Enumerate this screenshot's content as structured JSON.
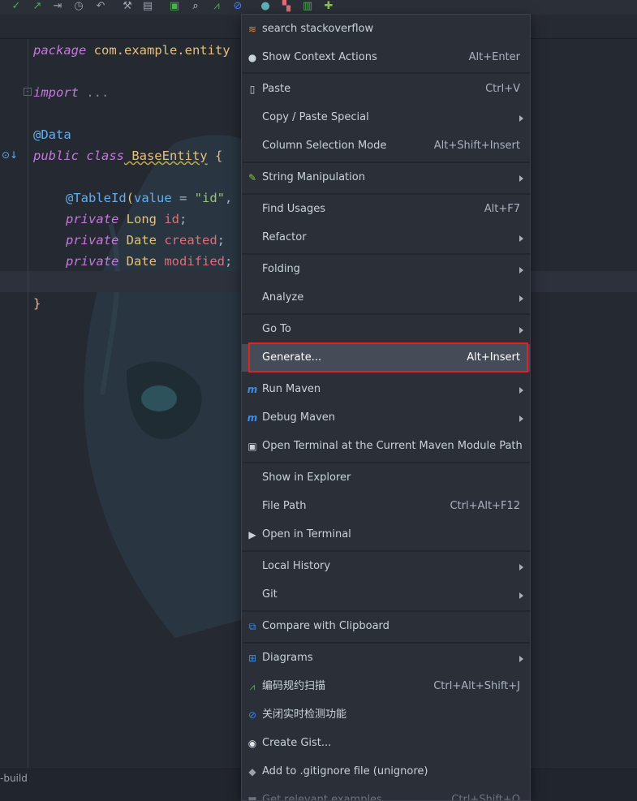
{
  "toolbar": {
    "icons": [
      "check-icon",
      "arrow-up-right-icon",
      "merge-icon",
      "history-icon",
      "undo-icon",
      "wrench-icon",
      "structure-icon",
      "terminal-icon",
      "search-icon",
      "activity-icon",
      "no-entry-icon",
      "bug-icon",
      "palette-icon",
      "db-icon",
      "plugin-icon"
    ]
  },
  "editor": {
    "code": {
      "l1_kw": "package",
      "l1_rest": " com.example.entity",
      "l3_kw": "import",
      "l3_rest": " ...",
      "l5": "@Data",
      "l6_kw": "public class",
      "l6_cls": " BaseEntity",
      "l6_rest": " {",
      "l8_ann": "@TableId",
      "l8_p1": "(",
      "l8_attr": "value",
      "l8_eq": " = ",
      "l8_str": "\"id\"",
      "l8_end": ",",
      "l9_kw": "private",
      "l9_ty": " Long",
      "l9_fld": " id",
      "l9_end": ";",
      "l10_kw": "private",
      "l10_ty": " Date",
      "l10_fld": " created",
      "l10_end": ";",
      "l11_kw": "private",
      "l11_ty": " Date",
      "l11_fld": " modified",
      "l11_end": ";",
      "l13": "}"
    }
  },
  "statusbar": {
    "text": "-build"
  },
  "menu": {
    "items": [
      {
        "label": "search stackoverflow",
        "shortcut": "",
        "submenu": false,
        "icon": "stackoverflow-icon"
      },
      {
        "label": "Show Context Actions",
        "shortcut": "Alt+Enter",
        "submenu": false,
        "icon": "lightbulb-icon"
      },
      {
        "label": "Paste",
        "shortcut": "Ctrl+V",
        "submenu": false,
        "icon": "clipboard-icon"
      },
      {
        "label": "Copy / Paste Special",
        "shortcut": "",
        "submenu": true,
        "icon": ""
      },
      {
        "label": "Column Selection Mode",
        "shortcut": "Alt+Shift+Insert",
        "submenu": false,
        "icon": ""
      },
      {
        "label": "String Manipulation",
        "shortcut": "",
        "submenu": true,
        "icon": "pencil-icon"
      },
      {
        "label": "Find Usages",
        "shortcut": "Alt+F7",
        "submenu": false,
        "icon": ""
      },
      {
        "label": "Refactor",
        "shortcut": "",
        "submenu": true,
        "icon": ""
      },
      {
        "label": "Folding",
        "shortcut": "",
        "submenu": true,
        "icon": ""
      },
      {
        "label": "Analyze",
        "shortcut": "",
        "submenu": true,
        "icon": ""
      },
      {
        "label": "Go To",
        "shortcut": "",
        "submenu": true,
        "icon": ""
      },
      {
        "label": "Generate...",
        "shortcut": "Alt+Insert",
        "submenu": false,
        "icon": "",
        "selected": true
      },
      {
        "label": "Run Maven",
        "shortcut": "",
        "submenu": true,
        "icon": "maven-run-icon"
      },
      {
        "label": "Debug Maven",
        "shortcut": "",
        "submenu": true,
        "icon": "maven-debug-icon"
      },
      {
        "label": "Open Terminal at the Current Maven Module Path",
        "shortcut": "",
        "submenu": false,
        "icon": "maven-terminal-icon"
      },
      {
        "label": "Show in Explorer",
        "shortcut": "",
        "submenu": false,
        "icon": ""
      },
      {
        "label": "File Path",
        "shortcut": "Ctrl+Alt+F12",
        "submenu": false,
        "icon": ""
      },
      {
        "label": "Open in Terminal",
        "shortcut": "",
        "submenu": false,
        "icon": "terminal-icon"
      },
      {
        "label": "Local History",
        "shortcut": "",
        "submenu": true,
        "icon": ""
      },
      {
        "label": "Git",
        "shortcut": "",
        "submenu": true,
        "icon": ""
      },
      {
        "label": "Compare with Clipboard",
        "shortcut": "",
        "submenu": false,
        "icon": "compare-icon"
      },
      {
        "label": "Diagrams",
        "shortcut": "",
        "submenu": true,
        "icon": "diagram-icon"
      },
      {
        "label": "编码规约扫描",
        "shortcut": "Ctrl+Alt+Shift+J",
        "submenu": false,
        "icon": "scan-icon"
      },
      {
        "label": "关闭实时检测功能",
        "shortcut": "",
        "submenu": false,
        "icon": "no-entry-icon"
      },
      {
        "label": "Create Gist...",
        "shortcut": "",
        "submenu": false,
        "icon": "github-icon"
      },
      {
        "label": "Add to .gitignore file (unignore)",
        "shortcut": "",
        "submenu": false,
        "icon": "gitignore-icon"
      },
      {
        "label": "Get relevant examples",
        "shortcut": "Ctrl+Shift+Q",
        "submenu": false,
        "icon": "examples-icon",
        "disabled": true
      }
    ]
  },
  "colors": {
    "accent": "#e02424",
    "selection": "#454b57",
    "menu_bg": "#2b2f38"
  }
}
